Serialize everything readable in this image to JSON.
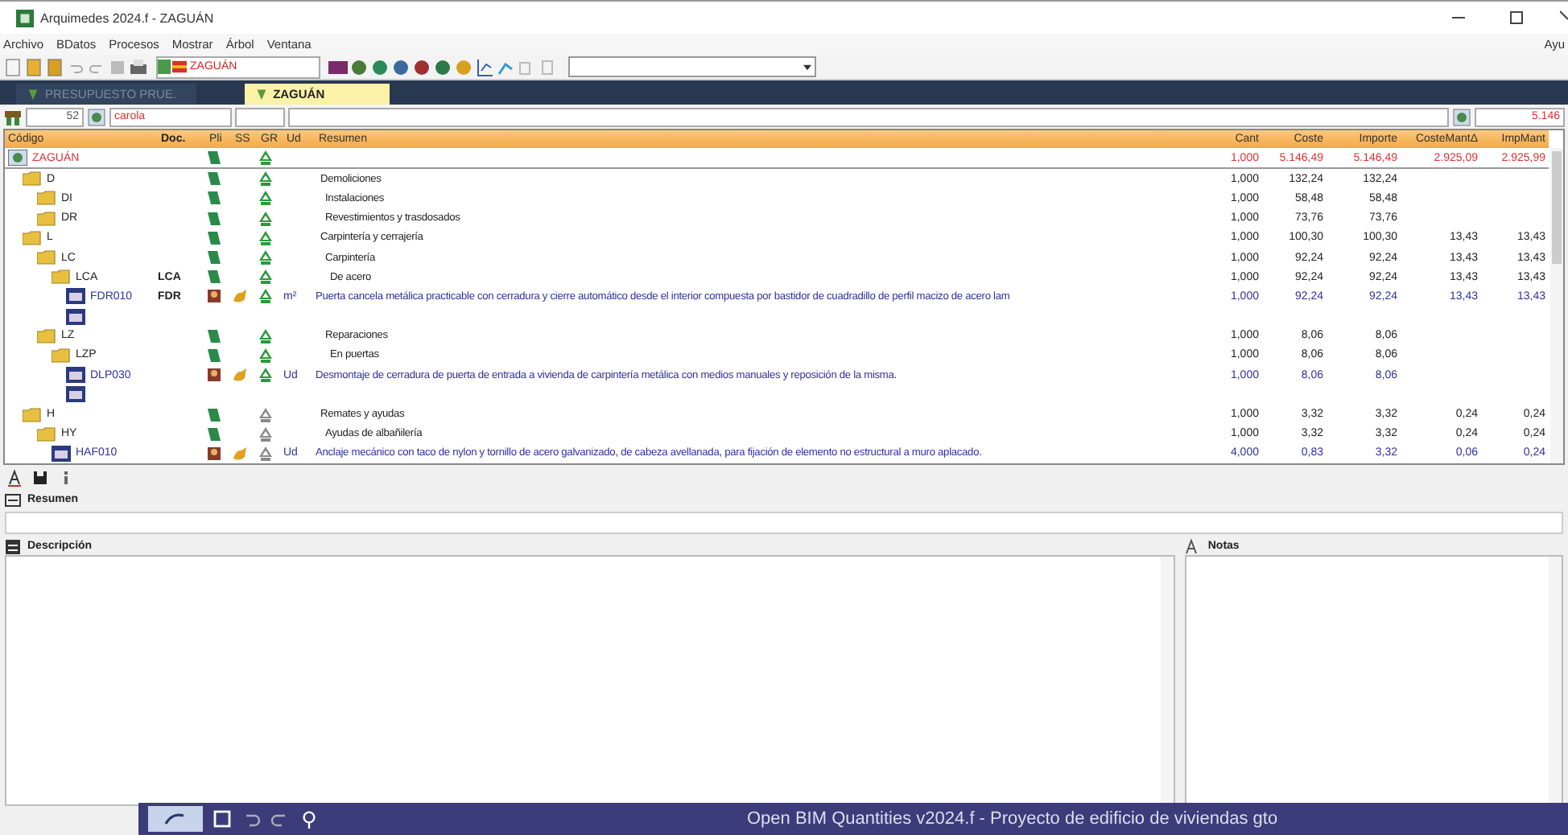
{
  "window": {
    "title": "Arquimedes 2024.f - ZAGUÁN"
  },
  "menu": {
    "items": [
      "Archivo",
      "BDatos",
      "Procesos",
      "Mostrar",
      "Árbol",
      "Ventana"
    ],
    "right": "Ayu"
  },
  "toolbar": {
    "combo": "ZAGUÁN"
  },
  "tabs": [
    {
      "label": "PRESUPUESTO PRUE.",
      "selected": false
    },
    {
      "label": "ZAGUÁN",
      "selected": true
    }
  ],
  "filter": {
    "number": "52",
    "text": "carola",
    "total": "5.146"
  },
  "table": {
    "columns": [
      "Código",
      "Doc.",
      "Pli",
      "SS",
      "GR",
      "Ud",
      "Resumen",
      "Cant",
      "Coste",
      "Importe",
      "CosteMantΔ",
      "ImpMant"
    ],
    "rows": [
      {
        "kind": "root",
        "code": "ZAGUÁN",
        "pli": true,
        "gr_active": true,
        "cant": "1,000",
        "coste": "5.146,49",
        "importe": "5.146,49",
        "cmant": "2.925,09",
        "imant": "2.925,99",
        "children": [
          {
            "kind": "chapter",
            "code": "D",
            "pli": true,
            "gr_active": true,
            "summary": "Demoliciones",
            "cant": "1,000",
            "coste": "132,24",
            "importe": "132,24",
            "children": [
              {
                "kind": "chapter",
                "code": "DI",
                "pli": true,
                "gr_active": true,
                "summary": "Instalaciones",
                "cant": "1,000",
                "coste": "58,48",
                "importe": "58,48"
              },
              {
                "kind": "chapter",
                "code": "DR",
                "pli": true,
                "gr_active": true,
                "summary": "Revestimientos y trasdosados",
                "cant": "1,000",
                "coste": "73,76",
                "importe": "73,76"
              }
            ]
          },
          {
            "kind": "chapter",
            "code": "L",
            "pli": true,
            "gr_active": true,
            "summary": "Carpintería y cerrajería",
            "cant": "1,000",
            "coste": "100,30",
            "importe": "100,30",
            "cmant": "13,43",
            "imant": "13,43",
            "children": [
              {
                "kind": "chapter",
                "code": "LC",
                "pli": true,
                "gr_active": true,
                "summary": "Carpintería",
                "cant": "1,000",
                "coste": "92,24",
                "importe": "92,24",
                "cmant": "13,43",
                "imant": "13,43",
                "children": [
                  {
                    "kind": "chapter",
                    "code": "LCA",
                    "doc": "LCA",
                    "pli": true,
                    "gr_active": true,
                    "summary": "De acero",
                    "cant": "1,000",
                    "coste": "92,24",
                    "importe": "92,24",
                    "cmant": "13,43",
                    "imant": "13,43",
                    "children": [
                      {
                        "kind": "item",
                        "code": "FDR010",
                        "doc": "FDR",
                        "gr_active": true,
                        "ud": "m²",
                        "summary": "Puerta cancela metálica practicable con cerradura y cierre automático desde el interior compuesta por bastidor de cuadradillo de perfil macizo de acero lam",
                        "cant": "1,000",
                        "coste": "92,24",
                        "importe": "92,24",
                        "cmant": "13,43",
                        "imant": "13,43"
                      },
                      {
                        "kind": "blank"
                      }
                    ]
                  }
                ]
              },
              {
                "kind": "chapter",
                "code": "LZ",
                "pli": true,
                "gr_active": true,
                "summary": "Reparaciones",
                "cant": "1,000",
                "coste": "8,06",
                "importe": "8,06",
                "children": [
                  {
                    "kind": "chapter",
                    "code": "LZP",
                    "pli": true,
                    "gr_active": true,
                    "summary": "En puertas",
                    "cant": "1,000",
                    "coste": "8,06",
                    "importe": "8,06",
                    "children": [
                      {
                        "kind": "item",
                        "code": "DLP030",
                        "gr_active": true,
                        "ud": "Ud",
                        "summary": "Desmontaje de cerradura de puerta de entrada a vivienda de carpintería metálica con medios manuales y reposición de la misma.",
                        "cant": "1,000",
                        "coste": "8,06",
                        "importe": "8,06"
                      },
                      {
                        "kind": "blank"
                      }
                    ]
                  }
                ]
              }
            ]
          },
          {
            "kind": "chapter",
            "code": "H",
            "pli": true,
            "gr_active": false,
            "summary": "Remates y ayudas",
            "cant": "1,000",
            "coste": "3,32",
            "importe": "3,32",
            "cmant": "0,24",
            "imant": "0,24",
            "children": [
              {
                "kind": "chapter",
                "code": "HY",
                "pli": true,
                "gr_active": false,
                "summary": "Ayudas de albañilería",
                "cant": "1,000",
                "coste": "3,32",
                "importe": "3,32",
                "cmant": "0,24",
                "imant": "0,24",
                "children": [
                  {
                    "kind": "item",
                    "code": "HAF010",
                    "gr_active": false,
                    "ud": "Ud",
                    "summary": "Anclaje mecánico con taco de nylon y tornillo de acero galvanizado, de cabeza avellanada, para fijación de elemento no estructural a muro aplacado.",
                    "cant": "4,000",
                    "coste": "0,83",
                    "importe": "3,32",
                    "cmant": "0,06",
                    "imant": "0,24"
                  }
                ]
              }
            ]
          }
        ]
      }
    ]
  },
  "resumen": {
    "label": "Resumen"
  },
  "descripcion": {
    "label": "Descripción"
  },
  "notas": {
    "label": "Notas"
  },
  "overlay": {
    "title": "Open BIM Quantities v2024.f - Proyecto de edificio de viviendas gto"
  }
}
